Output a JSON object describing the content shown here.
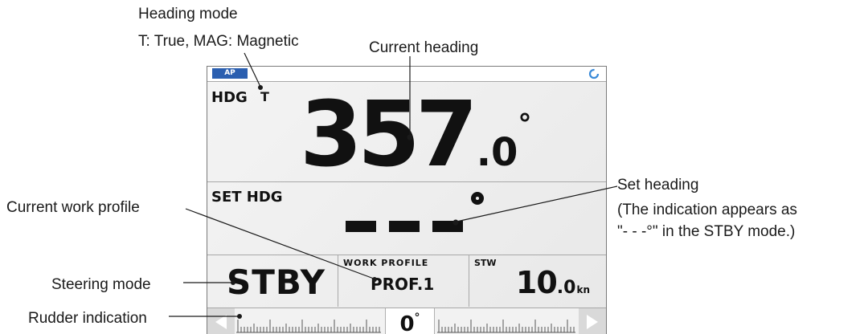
{
  "callouts": {
    "heading_mode_title": "Heading mode",
    "heading_mode_desc": "T: True, MAG: Magnetic",
    "current_heading": "Current heading",
    "set_heading_title": "Set heading",
    "set_heading_note1": "(The indication appears as",
    "set_heading_note2": "\"- - -°\" in the STBY mode.)",
    "current_work_profile": "Current work profile",
    "steering_mode": "Steering mode",
    "rudder_indication": "Rudder indication"
  },
  "display": {
    "mode_badge": "AP",
    "heading": {
      "label": "HDG",
      "mode_icon": "T",
      "value_int": "357",
      "value_dec": ".0",
      "degree": "°"
    },
    "set_heading": {
      "label": "SET HDG"
    },
    "steering_mode": "STBY",
    "work_profile": {
      "label": "WORK PROFILE",
      "value": "PROF.1"
    },
    "stw": {
      "label": "STW",
      "value_int": "10",
      "value_dec": ".0",
      "unit": "kn"
    },
    "rudder": {
      "value": "0",
      "degree": "°"
    }
  },
  "colors": {
    "badge": "#2b5fb0",
    "sync_icon": "#3a8ad8",
    "arrow": "#ffffff",
    "frame": "#7a7a7a"
  },
  "icons": {
    "sync": "refresh-icon",
    "left": "left-arrow-icon",
    "right": "right-arrow-icon"
  }
}
